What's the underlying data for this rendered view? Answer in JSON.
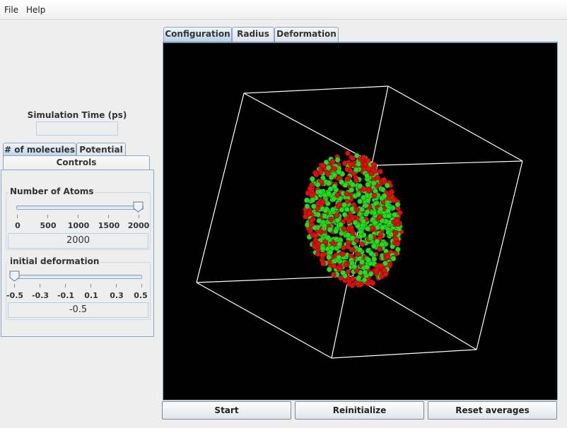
{
  "menubar": {
    "items": [
      "File",
      "Help"
    ]
  },
  "left_panel": {
    "simulation_time_label": "Simulation Time (ps)",
    "simulation_time_value": "",
    "tabs": [
      "# of molecules",
      "Potential"
    ],
    "controls_tab": "Controls",
    "number_of_atoms": {
      "title": "Number of Atoms",
      "ticks": [
        "0",
        "500",
        "1000",
        "1500",
        "2000"
      ],
      "min": 0,
      "max": 2000,
      "value": 2000,
      "field_value": "2000"
    },
    "initial_deformation": {
      "title": "initial deformation",
      "ticks": [
        "-0.5",
        "-0.3",
        "-0.1",
        "0.1",
        "0.3",
        "0.5"
      ],
      "min": -0.5,
      "max": 0.5,
      "value": -0.5,
      "field_value": "-0.5"
    }
  },
  "view_tabs": [
    "Configuration",
    "Radius",
    "Deformation"
  ],
  "selected_view_tab": "Configuration",
  "buttons": {
    "start": "Start",
    "reinitialize": "Reinitialize",
    "reset_averages": "Reset averages"
  },
  "colors": {
    "atom_primary": "#22dd22",
    "atom_secondary": "#dd1111",
    "box_wireframe": "#ffffff",
    "view_background": "#000000",
    "tab_selected": "#b8cfe5"
  }
}
